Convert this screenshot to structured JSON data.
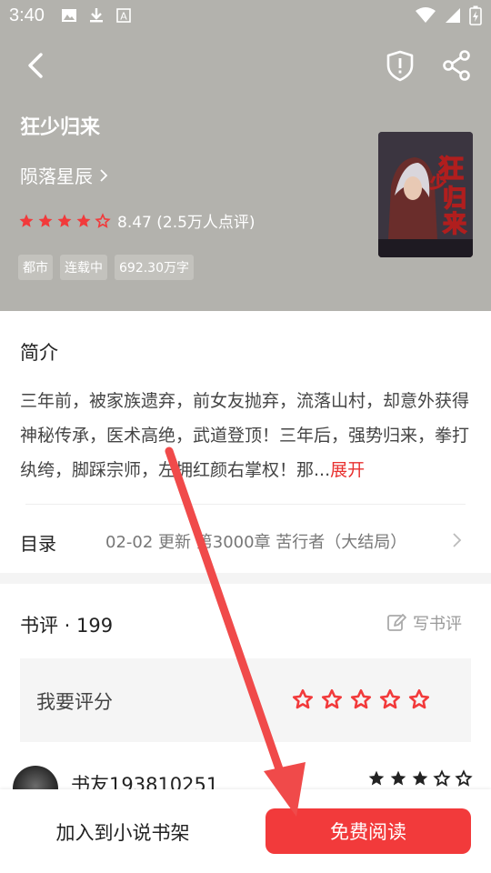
{
  "status_bar": {
    "time": "3:40",
    "left_icons": [
      "image-icon",
      "download-icon",
      "text-a-icon"
    ],
    "right_icons": [
      "wifi-icon",
      "signal-icon",
      "battery-charging-icon"
    ]
  },
  "nav": {
    "back_icon": "chevron-left-icon",
    "report_icon": "shield-icon",
    "share_icon": "share-icon"
  },
  "book": {
    "title": "狂少归来",
    "author": "陨落星辰",
    "score_text": "8.47 (2.5万人点评)",
    "stars_filled": 4.5,
    "tags": [
      "都市",
      "连载中",
      "692.30万字"
    ],
    "cover_title": "狂少归来"
  },
  "intro": {
    "heading": "简介",
    "text": "三年前，被家族遗弃，前女友抛弃，流落山村，却意外获得神秘传承，医术高绝，武道登顶！三年后，强势归来，拳打纨绔，脚踩宗师，左拥红颜右掌权！那...",
    "expand": "展开"
  },
  "toc": {
    "label": "目录",
    "update": "02-02  更新  第3000章 苦行者（大结局）"
  },
  "reviews": {
    "heading": "书评 · 199",
    "write_label": "写书评",
    "rate_label": "我要评分",
    "first_reviewer": "书友193810251",
    "first_reviewer_stars": 3
  },
  "bottom": {
    "shelf_button": "加入到小说书架",
    "read_button": "免费阅读"
  },
  "colors": {
    "hero_bg": "#b3b2ad",
    "accent_red": "#f23a3b",
    "annotation_arrow": "#f04a4a"
  }
}
